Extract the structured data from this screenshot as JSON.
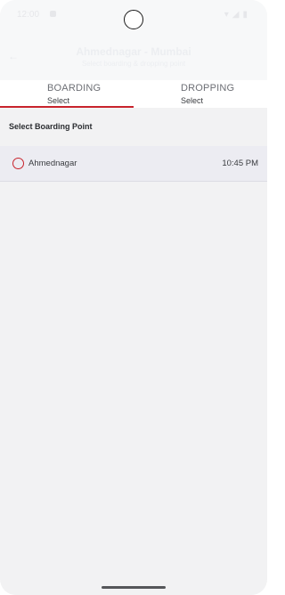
{
  "status_bar": {
    "time": "12:00"
  },
  "header": {
    "title": "Ahmednagar - Mumbai",
    "subtitle": "Select boarding & dropping point"
  },
  "tabs": [
    {
      "label": "BOARDING",
      "value": "Select",
      "active": true
    },
    {
      "label": "DROPPING",
      "value": "Select",
      "active": false
    }
  ],
  "section_title": "Select Boarding Point",
  "boarding_points": [
    {
      "name": "Ahmednagar",
      "time": "10:45 PM",
      "selected": false
    }
  ],
  "colors": {
    "accent": "#c8232c",
    "background": "#f2f2f3",
    "row_background": "#ececf2"
  },
  "icons": {
    "back": "arrow-left-icon",
    "radio": "radio-unselected-icon"
  }
}
